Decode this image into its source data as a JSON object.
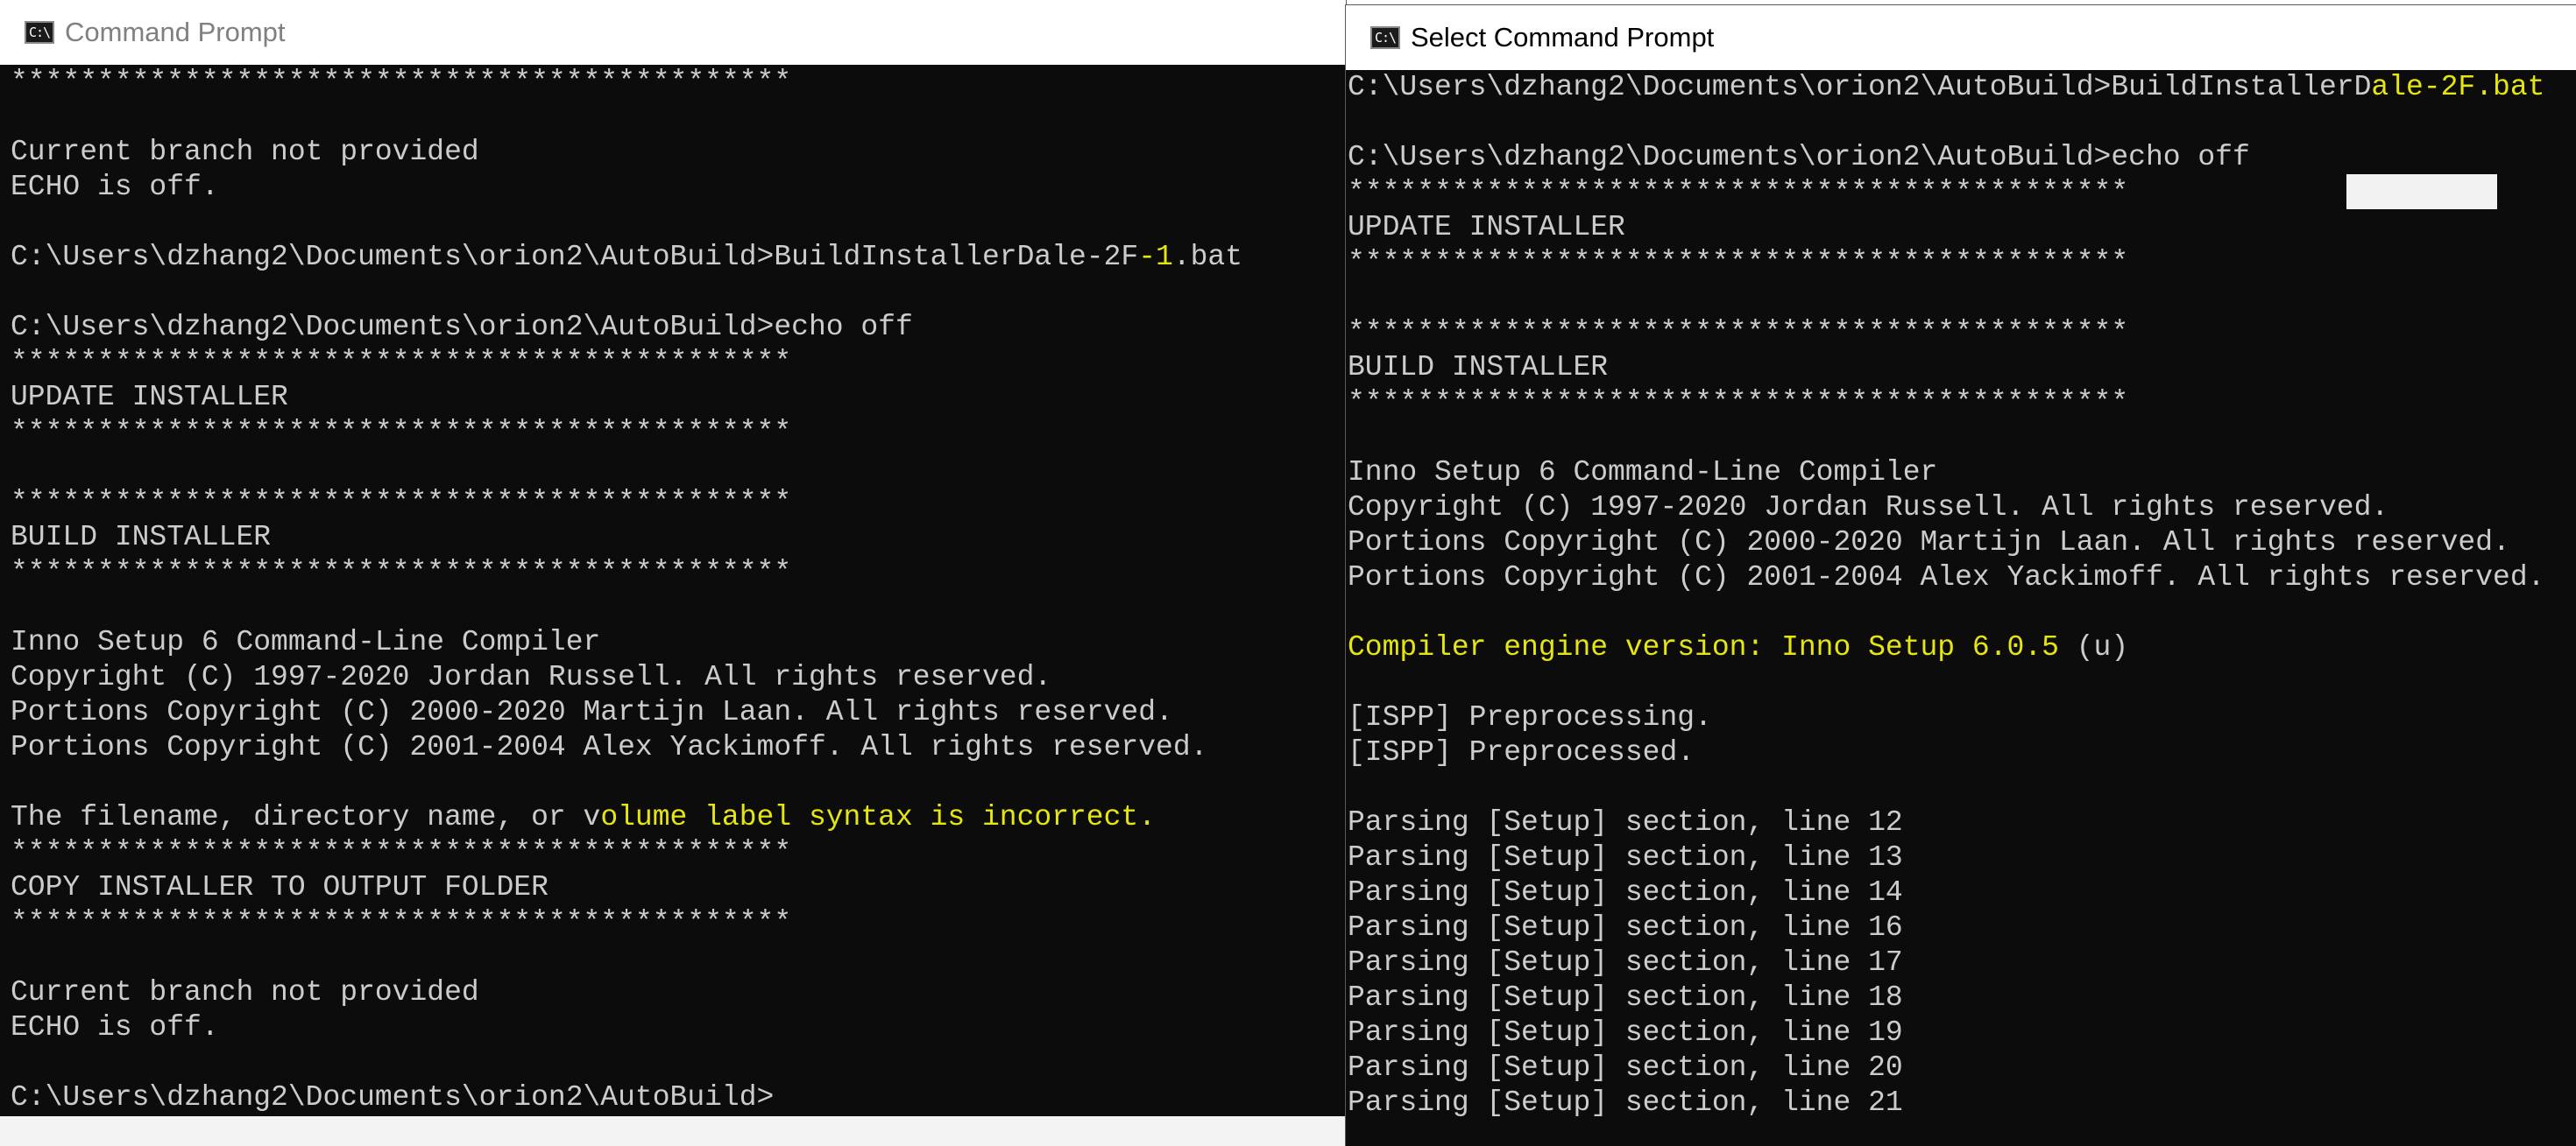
{
  "left_window": {
    "title": "Command Prompt",
    "lines": [
      "*********************************************",
      "",
      "Current branch not provided",
      "ECHO is off.",
      "",
      {
        "pre": "C:\\Users\\dzhang2\\Documents\\orion2\\AutoBuild>BuildInstallerDale-2F",
        "hl": "-1",
        "post": ".bat"
      },
      "",
      "C:\\Users\\dzhang2\\Documents\\orion2\\AutoBuild>echo off",
      "*********************************************",
      "UPDATE INSTALLER",
      "*********************************************",
      "",
      "*********************************************",
      "BUILD INSTALLER",
      "*********************************************",
      "",
      "Inno Setup 6 Command-Line Compiler",
      "Copyright (C) 1997-2020 Jordan Russell. All rights reserved.",
      "Portions Copyright (C) 2000-2020 Martijn Laan. All rights reserved.",
      "Portions Copyright (C) 2001-2004 Alex Yackimoff. All rights reserved.",
      "",
      {
        "pre": "The filename, directory name, or v",
        "hl": "olume label syntax is incorrect.",
        "post": ""
      },
      "*********************************************",
      "COPY INSTALLER TO OUTPUT FOLDER",
      "*********************************************",
      "",
      "Current branch not provided",
      "ECHO is off.",
      "",
      "C:\\Users\\dzhang2\\Documents\\orion2\\AutoBuild>"
    ]
  },
  "right_window": {
    "title": "Select Command Prompt",
    "lines": [
      {
        "pre": "C:\\Users\\dzhang2\\Documents\\orion2\\AutoBuild>BuildInstallerD",
        "hl": "ale-2F.bat",
        "post": ""
      },
      "",
      "C:\\Users\\dzhang2\\Documents\\orion2\\AutoBuild>echo off",
      "*********************************************",
      "UPDATE INSTALLER",
      "*********************************************",
      "",
      "*********************************************",
      "BUILD INSTALLER",
      "*********************************************",
      "",
      "Inno Setup 6 Command-Line Compiler",
      "Copyright (C) 1997-2020 Jordan Russell. All rights reserved.",
      "Portions Copyright (C) 2000-2020 Martijn Laan. All rights reserved.",
      "Portions Copyright (C) 2001-2004 Alex Yackimoff. All rights reserved.",
      "",
      {
        "pre": "",
        "hl": "Compiler engine version: Inno Setup 6.0.5",
        "post": " (u)"
      },
      "",
      "[ISPP] Preprocessing.",
      "[ISPP] Preprocessed.",
      "",
      "Parsing [Setup] section, line 12",
      "Parsing [Setup] section, line 13",
      "Parsing [Setup] section, line 14",
      "Parsing [Setup] section, line 16",
      "Parsing [Setup] section, line 17",
      "Parsing [Setup] section, line 18",
      "Parsing [Setup] section, line 19",
      "Parsing [Setup] section, line 20",
      "Parsing [Setup] section, line 21"
    ]
  },
  "icons": {
    "window_icon": "cmd-icon",
    "icon_glyph": "C:\\"
  },
  "colors": {
    "console_bg": "#0c0c0c",
    "console_text": "#cccccc",
    "highlight_text": "#e5e510",
    "titlebar_bg": "#ffffff"
  }
}
